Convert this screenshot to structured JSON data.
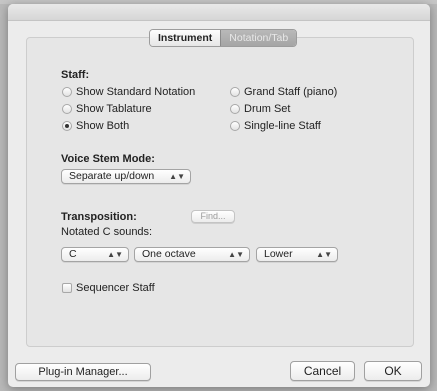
{
  "tabs": {
    "instrument": "Instrument",
    "notation_tab": "Notation/Tab"
  },
  "staff": {
    "heading": "Staff:",
    "options_left": [
      {
        "label": "Show Standard Notation",
        "checked": false
      },
      {
        "label": "Show Tablature",
        "checked": false
      },
      {
        "label": "Show Both",
        "checked": true
      }
    ],
    "options_right": [
      {
        "label": "Grand Staff (piano)",
        "checked": false
      },
      {
        "label": "Drum Set",
        "checked": false
      },
      {
        "label": "Single-line Staff",
        "checked": false
      }
    ]
  },
  "voice_stem": {
    "heading": "Voice Stem Mode:",
    "value": "Separate up/down"
  },
  "transposition": {
    "heading": "Transposition:",
    "find_label": "Find...",
    "notated_label": "Notated C sounds:",
    "note_value": "C",
    "interval_value": "One octave",
    "direction_value": "Lower"
  },
  "sequencer": {
    "label": "Sequencer Staff",
    "checked": false
  },
  "footer": {
    "plugin_manager": "Plug-in Manager...",
    "cancel": "Cancel",
    "ok": "OK"
  }
}
